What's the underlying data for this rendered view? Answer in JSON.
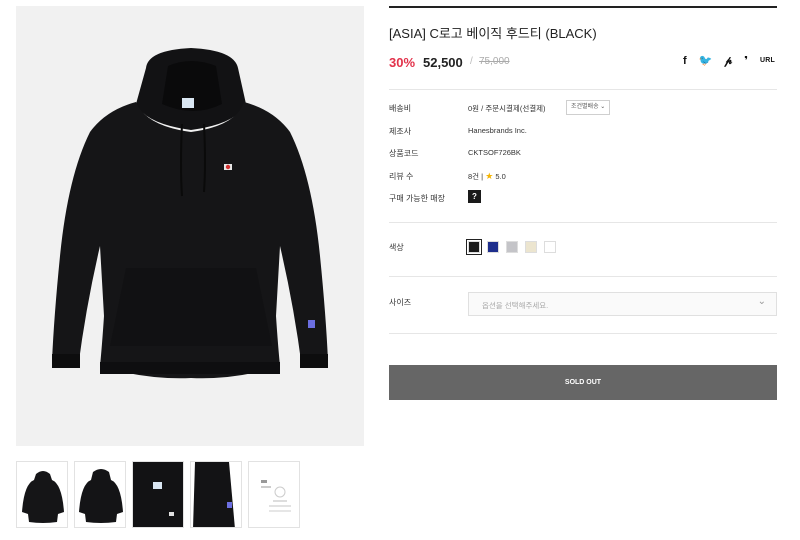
{
  "product": {
    "title": "[ASIA] C로고 베이직 후드티 (BLACK)",
    "discount": "30%",
    "price": "52,500",
    "price_slash": "/",
    "original_price": "75,000"
  },
  "share": {
    "facebook": "f",
    "twitter": "🐦",
    "pinterest": "𝓅",
    "kakao": "❜",
    "url": "URL"
  },
  "specs": {
    "shipping_label": "배송비",
    "shipping_value": "0원 / 주문시결제(선결제)",
    "shipping_button": "조건별배송 ⌄",
    "maker_label": "제조사",
    "maker_value": "Hanesbrands Inc.",
    "code_label": "상품코드",
    "code_value": "CKTSOF726BK",
    "review_label": "리뷰 수",
    "review_count": "8건 |",
    "review_star": "★",
    "review_score": "5.0",
    "store_label": "구매 가능한 매장",
    "store_button": "?"
  },
  "color": {
    "label": "색상",
    "swatches": [
      "#1a1a1a",
      "#1e2e8c",
      "#c4c4c8",
      "#ece5cf",
      "#ffffff"
    ]
  },
  "size": {
    "label": "사이즈",
    "placeholder": "옵션을 선택해주세요.",
    "chevron": "⌄"
  },
  "soldout_label": "SOLD OUT"
}
